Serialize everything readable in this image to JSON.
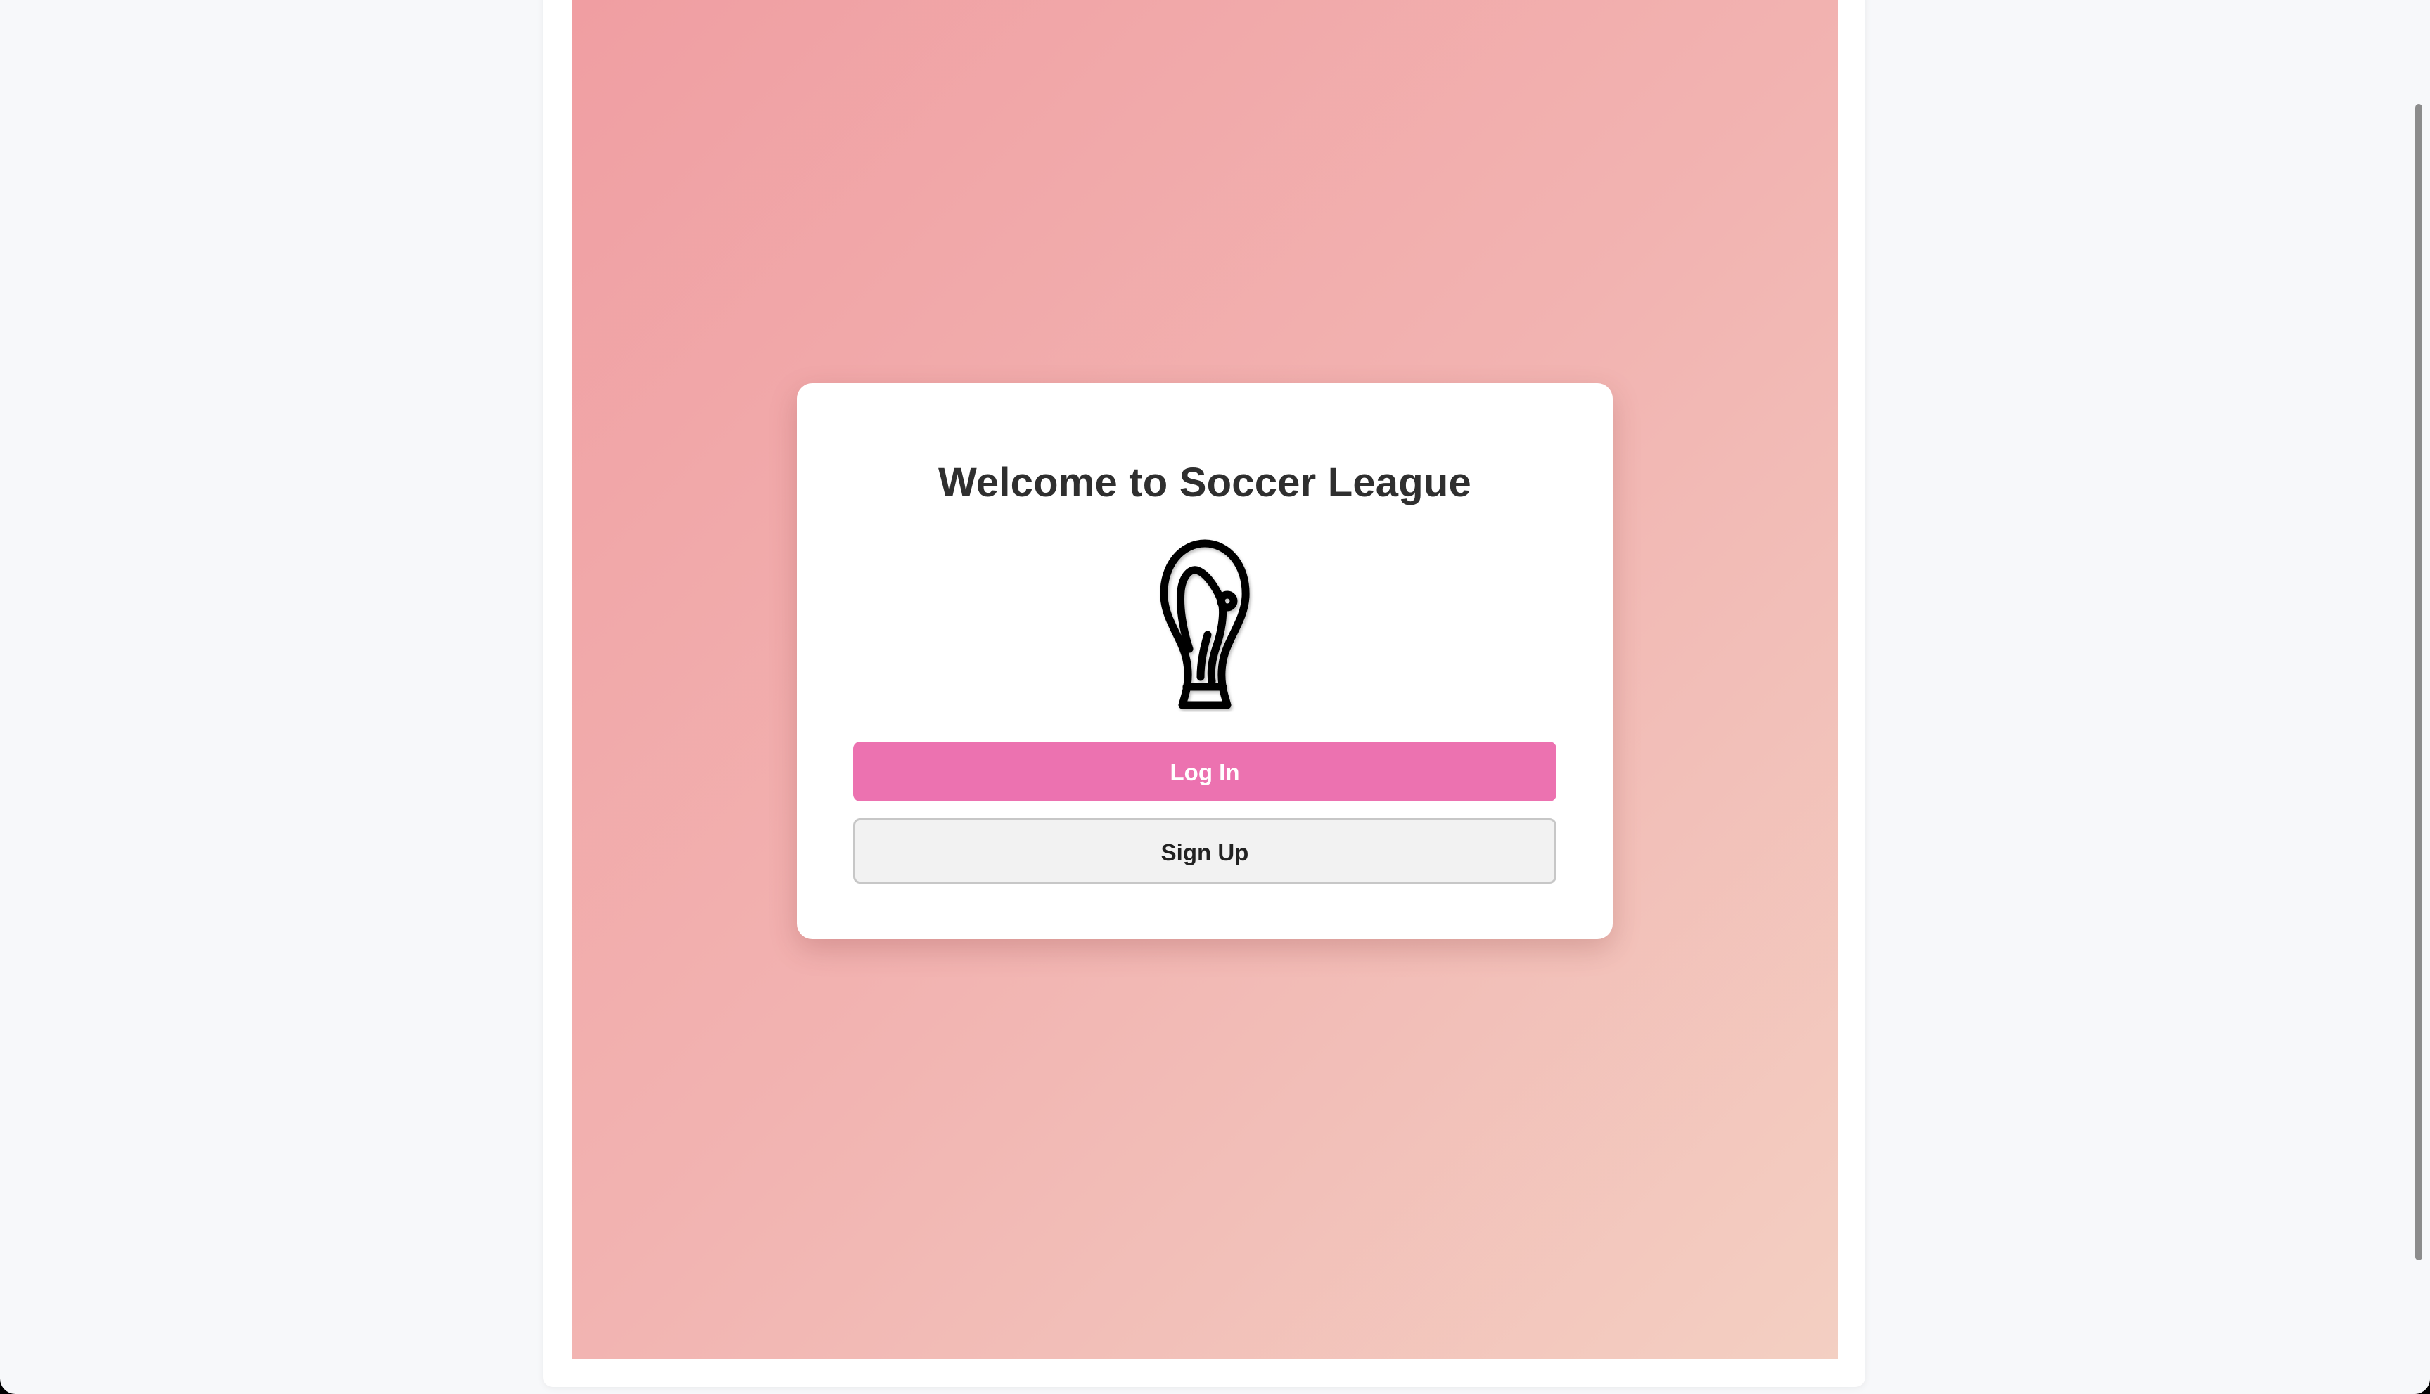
{
  "card": {
    "title": "Welcome to Soccer League",
    "icon": "trophy-icon",
    "login_label": "Log In",
    "signup_label": "Sign Up"
  },
  "colors": {
    "page_background": "#f7f8fa",
    "hero_gradient_start": "#f09ea2",
    "hero_gradient_end": "#f3cfc2",
    "login_button": "#ec72b0",
    "signup_button": "#f2f2f2",
    "title_text": "#2f2f2f"
  }
}
